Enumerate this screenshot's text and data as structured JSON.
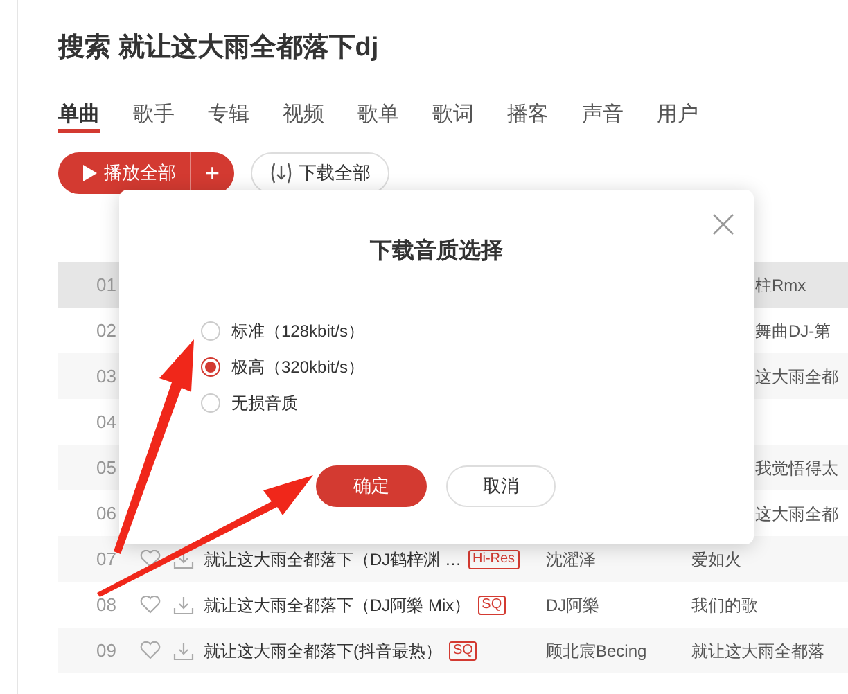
{
  "title": "搜索 就让这大雨全都落下dj",
  "tabs": [
    {
      "label": "单曲",
      "selected": true
    },
    {
      "label": "歌手",
      "selected": false
    },
    {
      "label": "专辑",
      "selected": false
    },
    {
      "label": "视频",
      "selected": false
    },
    {
      "label": "歌单",
      "selected": false
    },
    {
      "label": "歌词",
      "selected": false
    },
    {
      "label": "播客",
      "selected": false
    },
    {
      "label": "声音",
      "selected": false
    },
    {
      "label": "用户",
      "selected": false
    }
  ],
  "play_all": {
    "label": "播放全部",
    "add": "+"
  },
  "download_all": "下载全部",
  "rows": [
    {
      "index": "01",
      "album": "柱Rmx",
      "selected": true
    },
    {
      "index": "02",
      "album": "舞曲DJ-第",
      "selected": false
    },
    {
      "index": "03",
      "album": "这大雨全都",
      "selected": false
    },
    {
      "index": "04",
      "selected": false
    },
    {
      "index": "05",
      "album": "我觉悟得太",
      "selected": false
    },
    {
      "index": "06",
      "album": "这大雨全都",
      "selected": false
    },
    {
      "index": "07",
      "title": "就让这大雨全都落下（DJ鹤梓渊 …",
      "tag": "Hi-Res",
      "artist": "沈濯泽",
      "album": "爱如火",
      "selected": false
    },
    {
      "index": "08",
      "title": "就让这大雨全都落下（DJ阿樂 Mix）",
      "tag": "SQ",
      "artist": "DJ阿樂",
      "album": "我们的歌",
      "selected": false
    },
    {
      "index": "09",
      "title": "就让这大雨全都落下(抖音最热）",
      "tag": "SQ",
      "artist": "顾北宸Becing",
      "album": "就让这大雨全都落",
      "selected": false
    }
  ],
  "dialog": {
    "title": "下载音质选择",
    "options": [
      {
        "label": "标准（128kbit/s）",
        "selected": false
      },
      {
        "label": "极高（320kbit/s）",
        "selected": true
      },
      {
        "label": "无损音质",
        "selected": false
      }
    ],
    "confirm": "确定",
    "cancel": "取消"
  }
}
